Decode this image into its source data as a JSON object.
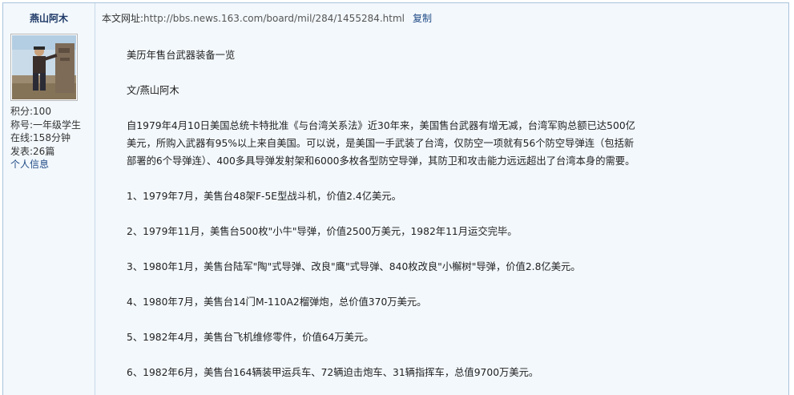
{
  "user": {
    "name": "燕山阿木",
    "stats": [
      "积分:100",
      "称号:一年级学生",
      "在线:158分钟",
      "发表:26篇"
    ],
    "profile_link": "个人信息"
  },
  "article": {
    "url_label": "本文网址:",
    "url": "http://bbs.news.163.com/board/mil/284/1455284.html",
    "copy_label": "复制",
    "title": "美历年售台武器装备一览",
    "author": "文/燕山阿木",
    "intro": "自1979年4月10日美国总统卡特批准《与台湾关系法》近30年来，美国售台武器有增无减，台湾军购总额已达500亿美元，所购入武器有95%以上来自美国。可以说，是美国一手武装了台湾，仅防空一项就有56个防空导弹连（包括新部署的6个导弹连）、400多具导弹发射架和6000多枚各型防空导弹，其防卫和攻击能力远远超出了台湾本身的需要。",
    "items": [
      "1、1979年7月，美售台48架F-5E型战斗机，价值2.4亿美元。",
      "2、1979年11月，美售台500枚\"小牛\"导弹，价值2500万美元，1982年11月运交完毕。",
      "3、1980年1月，美售台陆军\"陶\"式导弹、改良\"鹰\"式导弹、840枚改良\"小檞树\"导弹，价值2.8亿美元。",
      "4、1980年7月，美售台14门M-110A2榴弹炮，总价值370万美元。",
      "5、1982年4月，美售台飞机维修零件，价值64万美元。",
      "6、1982年6月，美售台164辆装甲运兵车、72辆迫击炮车、31辆指挥车，总值9700万美元。"
    ]
  }
}
